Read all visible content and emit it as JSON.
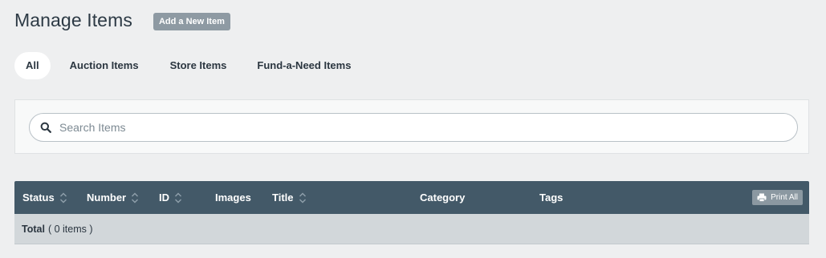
{
  "header": {
    "title": "Manage Items",
    "add_button": "Add a New Item"
  },
  "tabs": [
    {
      "label": "All",
      "active": true
    },
    {
      "label": "Auction Items",
      "active": false
    },
    {
      "label": "Store Items",
      "active": false
    },
    {
      "label": "Fund-a-Need Items",
      "active": false
    }
  ],
  "search": {
    "placeholder": "Search Items",
    "value": ""
  },
  "table": {
    "columns": [
      {
        "label": "Status",
        "sortable": true
      },
      {
        "label": "Number",
        "sortable": true
      },
      {
        "label": "ID",
        "sortable": true
      },
      {
        "label": "Images",
        "sortable": false
      },
      {
        "label": "Title",
        "sortable": true
      },
      {
        "label": "Category",
        "sortable": false
      },
      {
        "label": "Tags",
        "sortable": false
      }
    ],
    "print_label": "Print All",
    "total_label": "Total",
    "total_count": "( 0 items )"
  },
  "colors": {
    "background": "#eeeff0",
    "table_header": "#435968",
    "total_row": "#d2d7da",
    "button_gray": "#8e9aa3"
  },
  "icons": [
    "search-icon",
    "sort-icon",
    "printer-icon"
  ]
}
